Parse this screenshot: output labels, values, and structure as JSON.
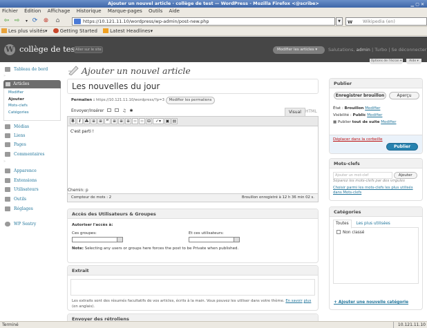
{
  "window": {
    "title": "Ajouter un nouvel article · collège de test — WordPress - Mozilla Firefox <@scribe>"
  },
  "menubar": [
    "Fichier",
    "Édition",
    "Affichage",
    "Historique",
    "Marque-pages",
    "Outils",
    "Aide"
  ],
  "nav": {
    "url": "https://10.121.11.10/wordpress/wp-admin/post-new.php",
    "search_placeholder": "Wikipedia (en)",
    "search_engine": "W"
  },
  "bookmarks": [
    "Les plus visités▾",
    "Getting Started",
    "Latest Headlines▾"
  ],
  "wp": {
    "site_name": "collège de test",
    "visit_site": "Aller sur le site",
    "favorite_action": "Modifier les articles",
    "greeting": "Salutations,",
    "user": "admin",
    "links": "| Turbo | Se déconnecter",
    "screen_options": "Options de l'écran ▾",
    "help": "Aide ▾"
  },
  "sidebar": {
    "dashboard": "Tableau de bord",
    "articles": "Articles",
    "articles_sub": [
      "Modifier",
      "Ajouter",
      "Mots-clefs",
      "Catégories"
    ],
    "items": [
      "Médias",
      "Liens",
      "Pages",
      "Commentaires",
      "Apparence",
      "Extensions",
      "Utilisateurs",
      "Outils",
      "Réglages",
      "WP Sentry"
    ]
  },
  "editor": {
    "page_title": "Ajouter un nouvel article",
    "post_title": "Les nouvelles du jour",
    "permalink_label": "Permalien :",
    "permalink_url": "https://10.121.11.10/wordpress/?p=3",
    "permalink_button": "Modifier les permaliens",
    "upload_label": "Envoyer/Insérer",
    "tab_visual": "Visual",
    "tab_html": "HTML",
    "content": "C'est parti !",
    "path": "Chemin: p",
    "word_count": "Compteur de mots : 2",
    "draft_saved": "Brouillon enregistré à 12 h 36 min 02 s."
  },
  "access": {
    "title": "Accès des Utilisateurs & Groupes",
    "label": "Autoriser l'accès à:",
    "groups": "Ces groupes:",
    "users": "Et ces utilisateurs:",
    "note_bold": "Note:",
    "note": "Selecting any users or groups here forces the post to be Private when published."
  },
  "excerpt": {
    "title": "Extrait",
    "note": "Les extraits sont des résumés facultatifs de vos articles, écrits à la main. Vous pouvez les utiliser dans votre thème.",
    "link1": "En savoir",
    "link2": "plus",
    "note_end": "(en anglais)."
  },
  "trackbacks": {
    "title": "Envoyer des rétroliens"
  },
  "publish": {
    "title": "Publier",
    "save_draft": "Enregistrer brouillon",
    "preview": "Aperçu",
    "status_label": "État :",
    "status_value": "Brouillon",
    "visibility_label": "Visibilité :",
    "visibility_value": "Public",
    "publish_label": "Publier",
    "publish_value": "tout de suite",
    "edit": "Modifier",
    "trash": "Déplacer dans la corbeille",
    "publish_button": "Publier"
  },
  "tags": {
    "title": "Mots-clefs",
    "placeholder": "Ajouter un mot-clef",
    "add": "Ajouter",
    "hint": "Séparez les mots-clefs par des virgules",
    "choose": "Choisir parmi les mots-clefs les plus utilisés dans Mots-clefs"
  },
  "categories": {
    "title": "Catégories",
    "tab_all": "Toutes",
    "tab_popular": "Les plus utilisées",
    "items": [
      "Non classé"
    ],
    "add_new": "+ Ajouter une nouvelle catégorie"
  },
  "status": {
    "text": "Terminé",
    "ip": "10.121.11.10"
  },
  "colors": {
    "wp_header": "#464646",
    "link": "#21759b",
    "publish": "#2782af",
    "trash": "#bc0b0b"
  }
}
